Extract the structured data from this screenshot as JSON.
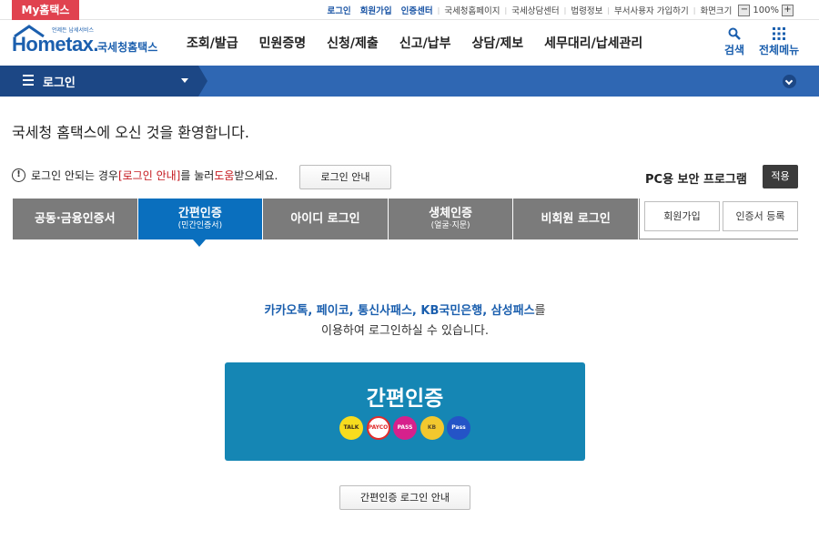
{
  "utilbar": {
    "my_tab": "My홈택스",
    "links": [
      "로그인",
      "회원가입",
      "인증센터"
    ],
    "plain_links": [
      "국세청홈페이지",
      "국세상담센터",
      "법령정보",
      "부서사용자 가입하기",
      "화면크기"
    ],
    "zoom_minus": "−",
    "zoom_value": "100%",
    "zoom_plus": "+"
  },
  "header": {
    "logo_tagline": "언제든 납세서비스",
    "logo_main": "Hometax.",
    "logo_sub": "국세청홈택스",
    "nav": [
      "조회/발급",
      "민원증명",
      "신청/제출",
      "신고/납부",
      "상담/제보",
      "세무대리/납세관리"
    ],
    "search_label": "검색",
    "menu_label": "전체메뉴"
  },
  "locbar": {
    "title": "로그인"
  },
  "welcome": "국세청 홈택스에 오신 것을 환영합니다.",
  "notice": {
    "part1": "로그인 안되는 경우 ",
    "red1": "[로그인 안내]",
    "part2": "를 눌러 ",
    "red2": "도움",
    "part3": "받으세요.",
    "guide_button": "로그인 안내"
  },
  "security": {
    "label": "PC용 보안 프로그램",
    "apply_button": "적용"
  },
  "tabs": [
    {
      "label": "공동·금융인증서",
      "sub": ""
    },
    {
      "label": "간편인증",
      "sub": "(민간인증서)"
    },
    {
      "label": "아이디 로그인",
      "sub": ""
    },
    {
      "label": "생체인증",
      "sub": "(얼굴·지문)"
    },
    {
      "label": "비회원 로그인",
      "sub": ""
    }
  ],
  "side_buttons": {
    "signup": "회원가입",
    "cert_register": "인증서 등록"
  },
  "easy": {
    "providers_line": "카카오톡, 페이코, 통신사패스, KB국민은행, 삼성패스",
    "providers_tail": "를",
    "line2": "이용하여 로그인하실 수 있습니다.",
    "box_title": "간편인증",
    "providers": [
      "TALK",
      "PAYCO",
      "PASS",
      "KB",
      "Pass"
    ],
    "guide_button": "간편인증 로그인 안내"
  }
}
